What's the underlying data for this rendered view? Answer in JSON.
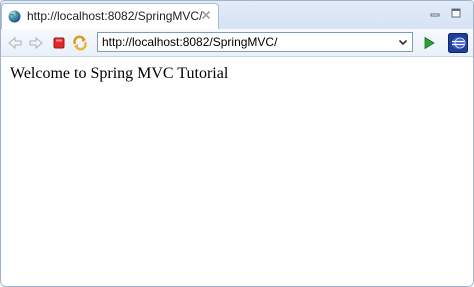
{
  "tab": {
    "title": "http://localhost:8082/SpringMVC/"
  },
  "toolbar": {
    "url": "http://localhost:8082/SpringMVC/"
  },
  "page": {
    "heading": "Welcome to Spring MVC Tutorial"
  },
  "icons": {
    "tab": "globe-icon",
    "tab_close": "close-icon",
    "minimize": "minimize-icon",
    "maximize": "maximize-icon",
    "back": "back-arrow-icon",
    "forward": "forward-arrow-icon",
    "stop": "stop-icon",
    "refresh": "refresh-icon",
    "dropdown": "chevron-down-icon",
    "go": "go-icon",
    "eclipse": "eclipse-icon"
  },
  "colors": {
    "frame_border": "#9fb3cc",
    "tabstrip_bg": "#dbe6f5",
    "stop_red": "#e2272b",
    "go_green": "#2f9e3a"
  }
}
